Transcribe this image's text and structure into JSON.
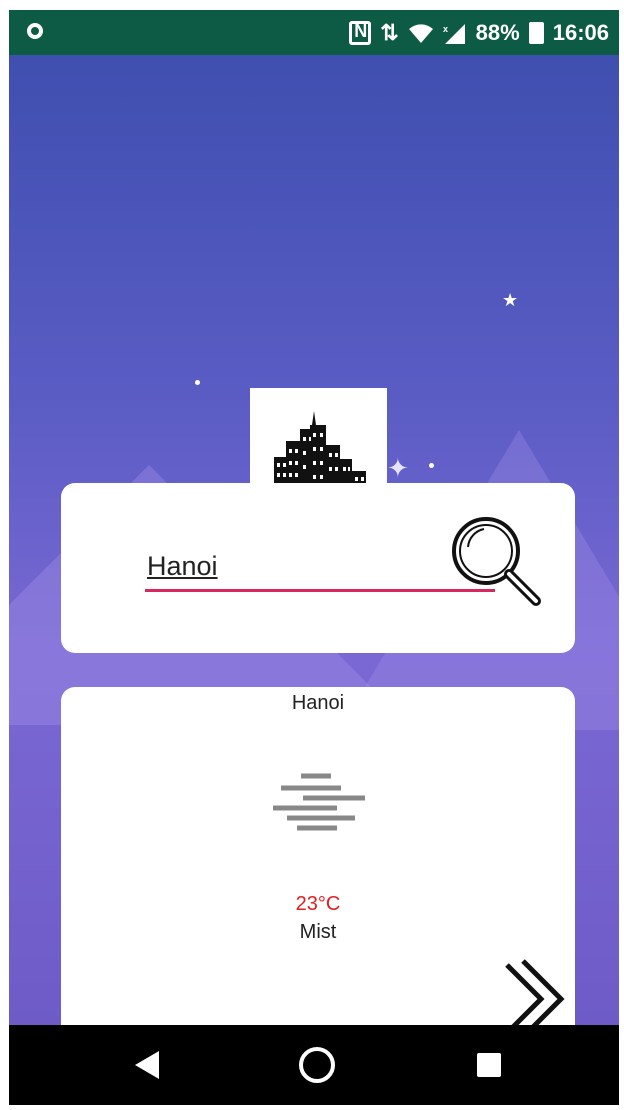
{
  "status_bar": {
    "battery": "88%",
    "time": "16:06"
  },
  "search": {
    "value": "Hanoi",
    "placeholder": ""
  },
  "weather": {
    "city": "Hanoi",
    "temperature": "23°C",
    "condition": "Mist",
    "icon": "mist-icon"
  },
  "colors": {
    "status_bar_bg": "#0d5a45",
    "input_underline": "#d8275d",
    "temperature_text": "#e02020"
  }
}
